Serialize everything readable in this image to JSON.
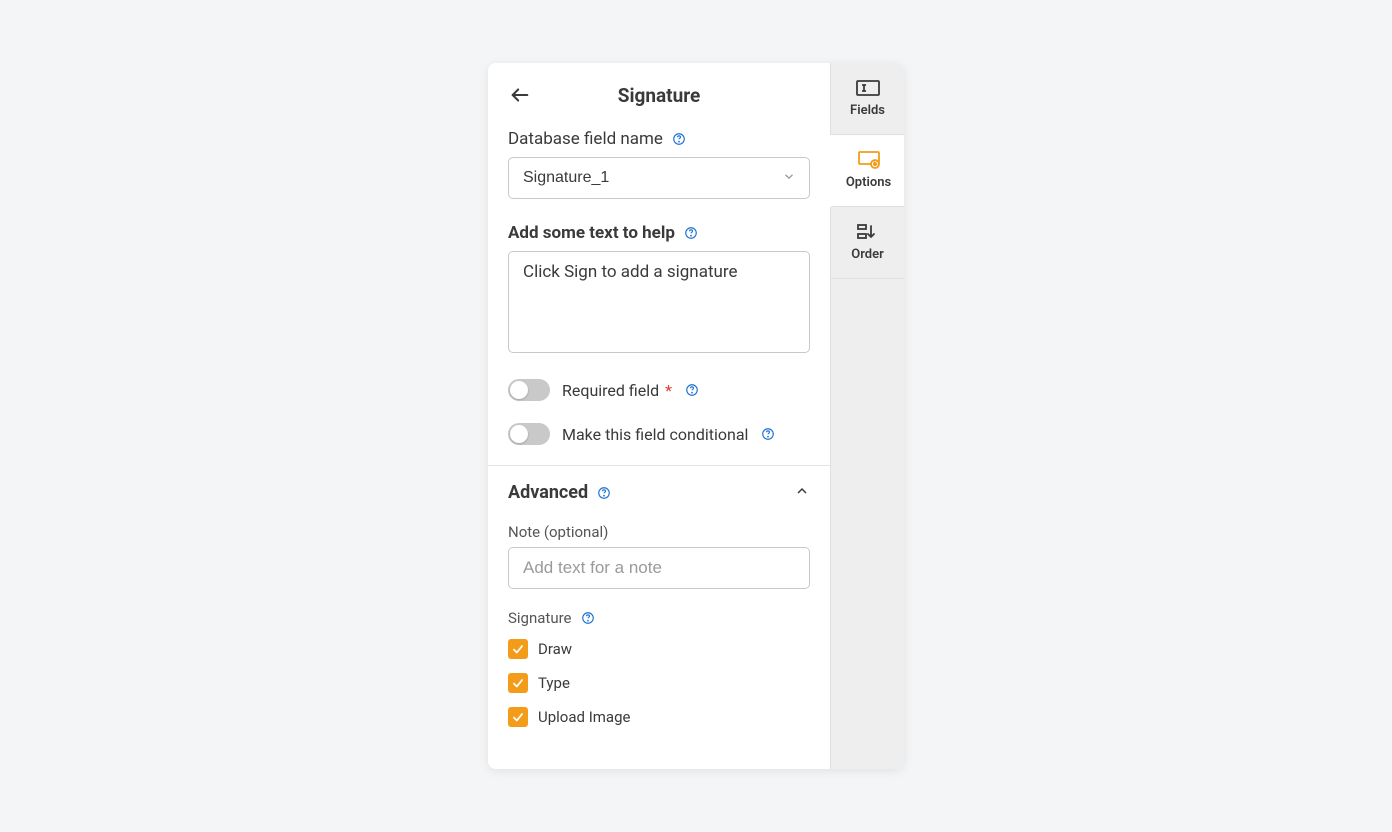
{
  "header": {
    "title": "Signature"
  },
  "db_field": {
    "label": "Database field name",
    "value": "Signature_1"
  },
  "help_text": {
    "label": "Add some text to help",
    "value": "Click Sign to add a signature"
  },
  "toggles": {
    "required_label": "Required field",
    "conditional_label": "Make this field conditional"
  },
  "advanced": {
    "title": "Advanced",
    "note_label": "Note (optional)",
    "note_placeholder": "Add text for a note",
    "signature_label": "Signature",
    "options": {
      "draw": "Draw",
      "type": "Type",
      "upload": "Upload Image"
    }
  },
  "tabs": {
    "fields": "Fields",
    "options": "Options",
    "order": "Order"
  }
}
